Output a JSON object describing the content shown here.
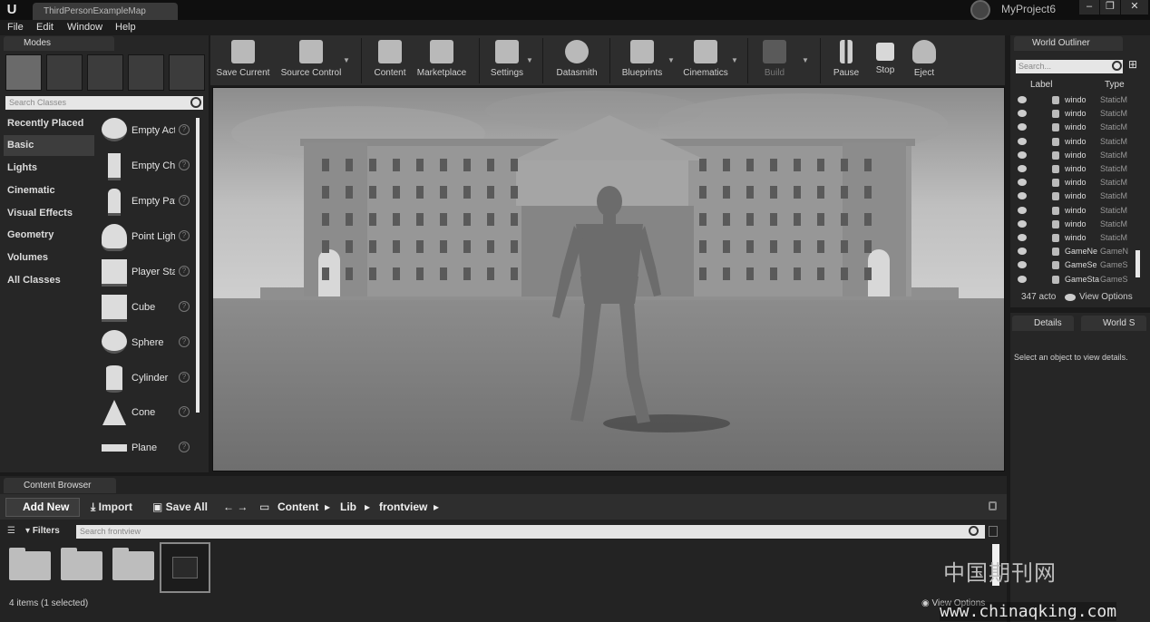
{
  "app": {
    "map_tab": "ThirdPersonExampleMap",
    "project_name": "MyProject6",
    "window_buttons": [
      "–",
      "❐",
      "✕"
    ]
  },
  "menu": [
    "File",
    "Edit",
    "Window",
    "Help"
  ],
  "modes": {
    "title": "Modes",
    "search_placeholder": "Search Classes",
    "categories": [
      "Recently Placed",
      "Basic",
      "Lights",
      "Cinematic",
      "Visual Effects",
      "Geometry",
      "Volumes",
      "All Classes"
    ],
    "selected_category": "Basic",
    "classes": [
      "Empty Actor",
      "Empty Character",
      "Empty Pawn",
      "Point Light",
      "Player Start",
      "Cube",
      "Sphere",
      "Cylinder",
      "Cone",
      "Plane"
    ]
  },
  "toolbar": {
    "items": [
      {
        "label": "Save Current",
        "icon": "save-icon"
      },
      {
        "label": "Source Control",
        "icon": "source-control-icon"
      },
      {
        "label": "Content",
        "icon": "content-icon"
      },
      {
        "label": "Marketplace",
        "icon": "marketplace-icon"
      },
      {
        "label": "Settings",
        "icon": "settings-icon"
      },
      {
        "label": "Datasmith",
        "icon": "datasmith-icon"
      },
      {
        "label": "Blueprints",
        "icon": "blueprints-icon"
      },
      {
        "label": "Cinematics",
        "icon": "cinematics-icon"
      },
      {
        "label": "Build",
        "icon": "build-icon"
      },
      {
        "label": "Pause",
        "icon": "pause-icon"
      },
      {
        "label": "Stop",
        "icon": "stop-icon"
      },
      {
        "label": "Eject",
        "icon": "eject-icon"
      }
    ]
  },
  "outliner": {
    "title": "World Outliner",
    "search_placeholder": "Search...",
    "col_label": "Label",
    "col_type": "Type",
    "rows": [
      {
        "name": "windo",
        "type": "StaticM"
      },
      {
        "name": "windo",
        "type": "StaticM"
      },
      {
        "name": "windo",
        "type": "StaticM"
      },
      {
        "name": "windo",
        "type": "StaticM"
      },
      {
        "name": "windo",
        "type": "StaticM"
      },
      {
        "name": "windo",
        "type": "StaticM"
      },
      {
        "name": "windo",
        "type": "StaticM"
      },
      {
        "name": "windo",
        "type": "StaticM"
      },
      {
        "name": "windo",
        "type": "StaticM"
      },
      {
        "name": "windo",
        "type": "StaticM"
      },
      {
        "name": "windo",
        "type": "StaticM"
      },
      {
        "name": "GameNe",
        "type": "GameN"
      },
      {
        "name": "GameSe",
        "type": "GameS"
      },
      {
        "name": "GameSta",
        "type": "GameS"
      }
    ],
    "count": "347 acto",
    "view_options": "View Options"
  },
  "details": {
    "tab_details": "Details",
    "tab_world": "World S",
    "message": "Select an object to view details."
  },
  "content_browser": {
    "title": "Content Browser",
    "add_new": "Add New",
    "import": "Import",
    "save_all": "Save All",
    "path": [
      "Content",
      "Lib",
      "frontview"
    ],
    "filters": "Filters",
    "search_placeholder": "Search frontview",
    "status": "4 items (1 selected)",
    "view_options": "View Options"
  },
  "watermark": {
    "cn": "中国期刊网",
    "url": "www.chinaqking.com"
  }
}
